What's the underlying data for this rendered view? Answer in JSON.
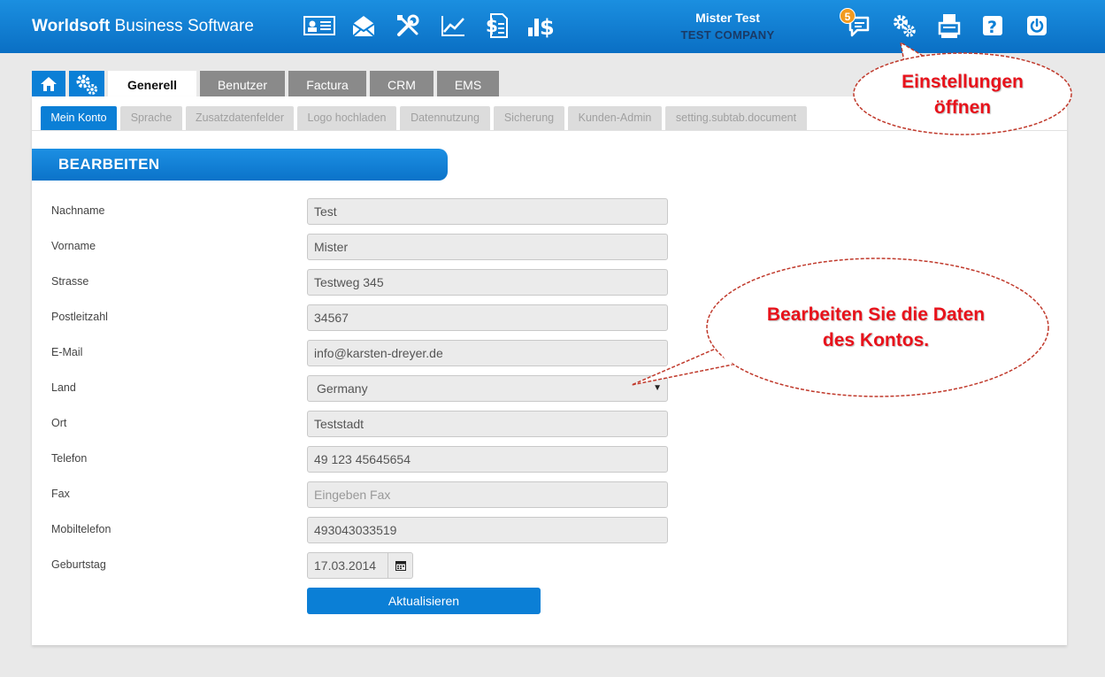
{
  "app": {
    "brand_bold": "Worldsoft",
    "brand_rest": " Business Software"
  },
  "top_icons": [
    "contact-card-icon",
    "mail-icon",
    "tools-icon",
    "chart-icon",
    "invoice-icon",
    "finance-icon"
  ],
  "user": {
    "name": "Mister Test",
    "company": "TEST COMPANY"
  },
  "notifications": {
    "count": "5"
  },
  "right_icons": [
    "messages-icon",
    "settings-gears-icon",
    "fax-icon",
    "help-icon",
    "power-icon"
  ],
  "main_tabs": [
    {
      "label": "",
      "icon": "home-icon"
    },
    {
      "label": "",
      "icon": "gears-icon"
    },
    {
      "label": "Generell",
      "active": true
    },
    {
      "label": "Benutzer"
    },
    {
      "label": "Factura"
    },
    {
      "label": "CRM"
    },
    {
      "label": "EMS"
    }
  ],
  "sub_tabs": [
    {
      "label": "Mein Konto",
      "active": true
    },
    {
      "label": "Sprache"
    },
    {
      "label": "Zusatzdatenfelder"
    },
    {
      "label": "Logo hochladen"
    },
    {
      "label": "Datennutzung"
    },
    {
      "label": "Sicherung"
    },
    {
      "label": "Kunden-Admin"
    },
    {
      "label": "setting.subtab.document"
    }
  ],
  "section_title": "BEARBEITEN",
  "form": {
    "nachname": {
      "label": "Nachname",
      "value": "Test"
    },
    "vorname": {
      "label": "Vorname",
      "value": "Mister"
    },
    "strasse": {
      "label": "Strasse",
      "value": "Testweg 345"
    },
    "plz": {
      "label": "Postleitzahl",
      "value": "34567"
    },
    "email": {
      "label": "E-Mail",
      "value": "info@karsten-dreyer.de"
    },
    "land": {
      "label": "Land",
      "value": "Germany"
    },
    "ort": {
      "label": "Ort",
      "value": "Teststadt"
    },
    "telefon": {
      "label": "Telefon",
      "value": "49 123 45645654"
    },
    "fax": {
      "label": "Fax",
      "value": "",
      "placeholder": "Eingeben Fax"
    },
    "mobil": {
      "label": "Mobiltelefon",
      "value": "493043033519"
    },
    "geburtstag": {
      "label": "Geburtstag",
      "value": "17.03.2014"
    }
  },
  "submit_label": "Aktualisieren",
  "callouts": {
    "settings_line1": "Einstellungen",
    "settings_line2": "öffnen",
    "edit_line1": "Bearbeiten Sie die Daten",
    "edit_line2": "des Kontos."
  },
  "colors": {
    "topbar": "#0b7fd6",
    "accent": "#0b7fd6",
    "callout_text": "#e8121b",
    "tab_inactive": "#8a8a8a"
  }
}
